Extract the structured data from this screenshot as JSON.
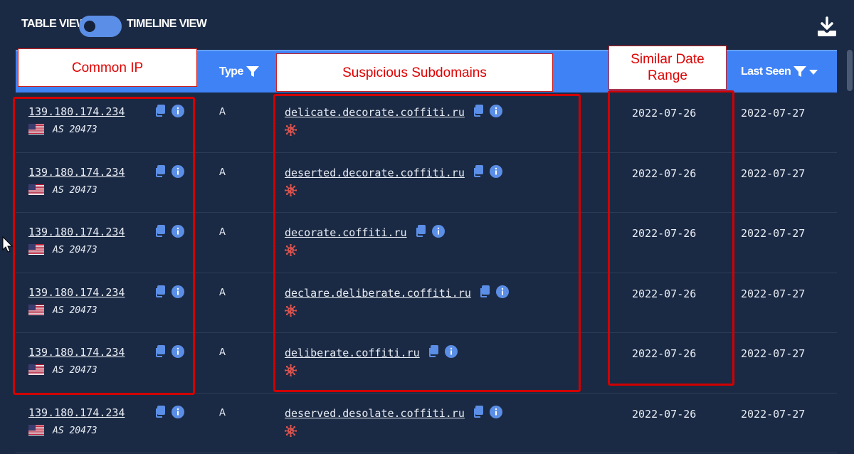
{
  "toolbar": {
    "table_view_label": "TABLE VIEW",
    "timeline_view_label": "TIMELINE VIEW",
    "download_icon": "download-icon"
  },
  "table": {
    "headers": {
      "type": "Type",
      "last_seen": "Last Seen"
    },
    "rows": [
      {
        "ip": "139.180.174.234",
        "asn": "AS 20473",
        "type": "A",
        "domain": "delicate.decorate.coffiti.ru",
        "first_seen": "2022-07-26",
        "last_seen": "2022-07-27"
      },
      {
        "ip": "139.180.174.234",
        "asn": "AS 20473",
        "type": "A",
        "domain": "deserted.decorate.coffiti.ru",
        "first_seen": "2022-07-26",
        "last_seen": "2022-07-27"
      },
      {
        "ip": "139.180.174.234",
        "asn": "AS 20473",
        "type": "A",
        "domain": "decorate.coffiti.ru",
        "first_seen": "2022-07-26",
        "last_seen": "2022-07-27"
      },
      {
        "ip": "139.180.174.234",
        "asn": "AS 20473",
        "type": "A",
        "domain": "declare.deliberate.coffiti.ru",
        "first_seen": "2022-07-26",
        "last_seen": "2022-07-27"
      },
      {
        "ip": "139.180.174.234",
        "asn": "AS 20473",
        "type": "A",
        "domain": "deliberate.coffiti.ru",
        "first_seen": "2022-07-26",
        "last_seen": "2022-07-27"
      },
      {
        "ip": "139.180.174.234",
        "asn": "AS 20473",
        "type": "A",
        "domain": "deserved.desolate.coffiti.ru",
        "first_seen": "2022-07-26",
        "last_seen": "2022-07-27"
      }
    ]
  },
  "annotations": {
    "common_ip": "Common IP",
    "suspicious_subdomains": "Suspicious Subdomains",
    "similar_date_range_line1": "Similar Date",
    "similar_date_range_line2": "Range"
  },
  "colors": {
    "background": "#1b2a44",
    "header": "#3f82f6",
    "accent": "#5b8ee6",
    "annotation_red": "#d10000",
    "malware_icon": "#d9534f"
  }
}
